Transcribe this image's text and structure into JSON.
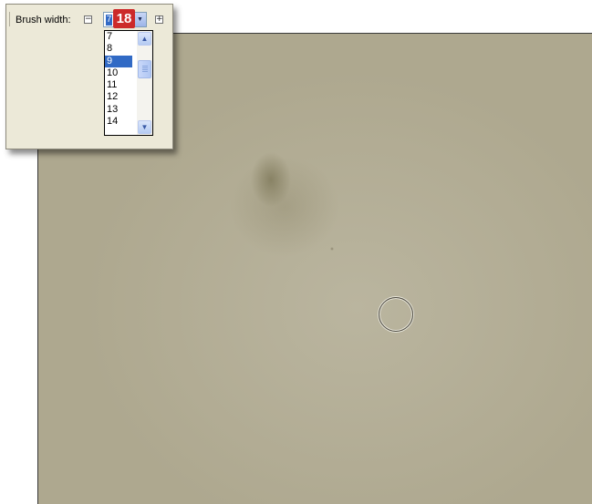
{
  "toolbar": {
    "brush_width_label": "Brush width:",
    "minus_icon": "minus-box-icon",
    "plus_icon": "plus-box-icon",
    "combo_value": "7",
    "value_badge": "18",
    "dropdown_arrow_icon": "chevron-down-icon"
  },
  "dropdown": {
    "items": [
      "7",
      "8",
      "9",
      "10",
      "11",
      "12",
      "13",
      "14"
    ],
    "selected": "9",
    "scroll_up_icon": "chevron-up-icon",
    "scroll_down_icon": "chevron-down-icon"
  },
  "canvas": {
    "cursor": "brush-circle-cursor"
  },
  "colors": {
    "selection": "#316ac5",
    "badge": "#cc2a2a",
    "canvas": "#b3ad96",
    "toolbar_bg": "#ece9d8"
  }
}
